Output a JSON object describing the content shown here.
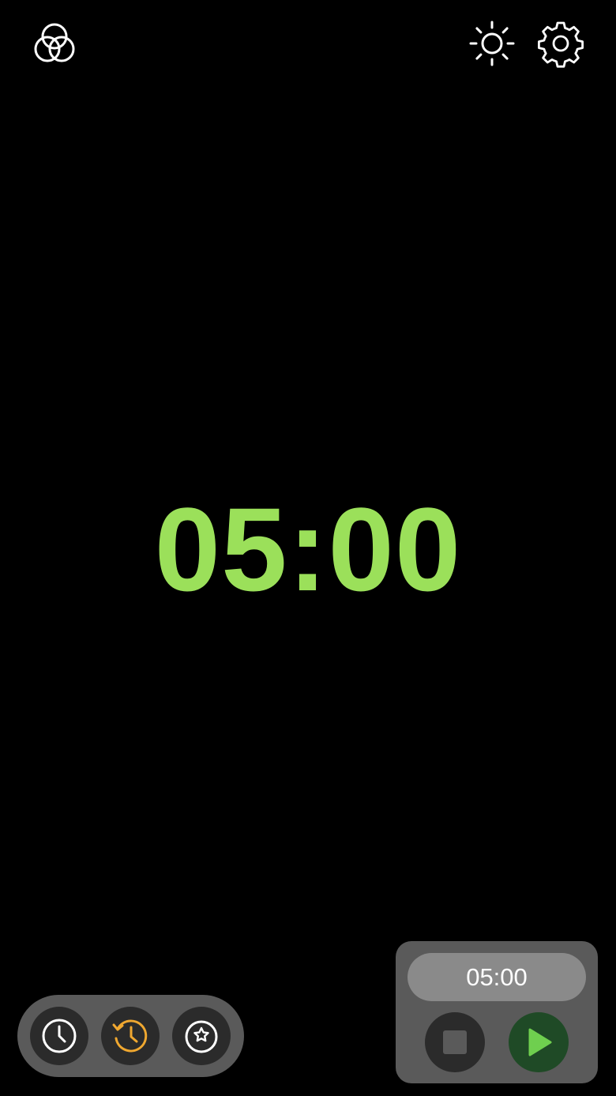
{
  "timer": {
    "display": "05:00",
    "color": "#9be05a"
  },
  "top_bar": {
    "left_icon": "color-filter-icon",
    "right_icons": [
      "brightness-icon",
      "gear-icon"
    ]
  },
  "mode_bar": {
    "items": [
      {
        "icon": "clock-icon",
        "active": false
      },
      {
        "icon": "timer-countdown-icon",
        "active": true
      },
      {
        "icon": "stopwatch-icon",
        "active": false
      }
    ],
    "active_color": "#f0a830"
  },
  "control_panel": {
    "duration": "05:00",
    "stop_icon": "stop-icon",
    "play_icon": "play-icon",
    "play_color": "#6fcf4f"
  }
}
